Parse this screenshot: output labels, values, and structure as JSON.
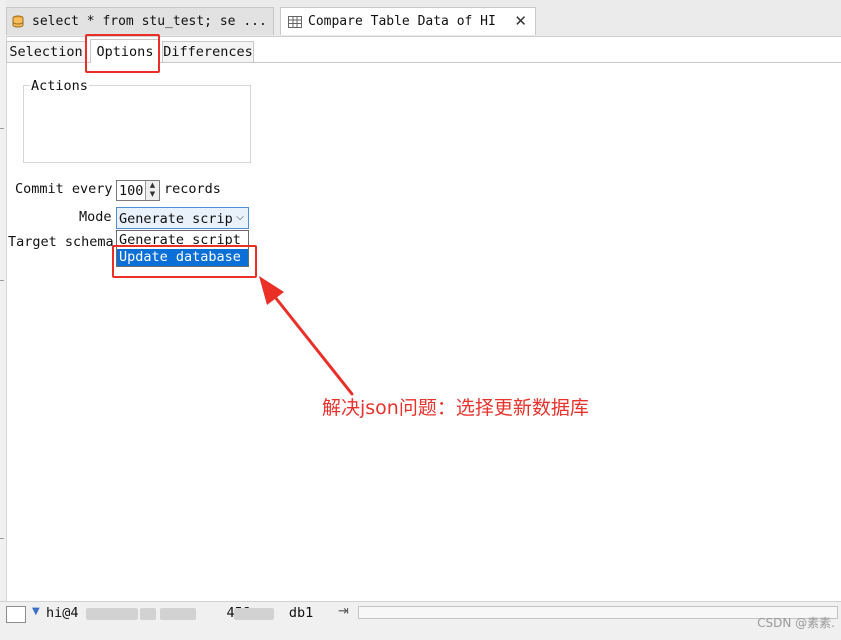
{
  "editor_tabs": [
    {
      "label": "select * from stu_test; se ..."
    },
    {
      "label": "Compare Table Data of HI"
    }
  ],
  "inner_tabs": [
    {
      "label": "Selection"
    },
    {
      "label": "Options"
    },
    {
      "label": "Differences"
    }
  ],
  "options": {
    "actions_label": "Actions",
    "commit_prefix": "Commit every",
    "commit_value": "100",
    "commit_suffix": "records",
    "mode_label": "Mode",
    "mode_value": "Generate scrip",
    "target_schema_label": "Target schema",
    "mode_options": [
      "Generate script",
      "Update database"
    ]
  },
  "annotation": {
    "text": "解决json问题：选择更新数据库",
    "color": "#e8332c"
  },
  "status": {
    "connection_start": "hi@4",
    "connection_mid": "458",
    "connection_end": "db1"
  },
  "watermark": "CSDN @素素."
}
